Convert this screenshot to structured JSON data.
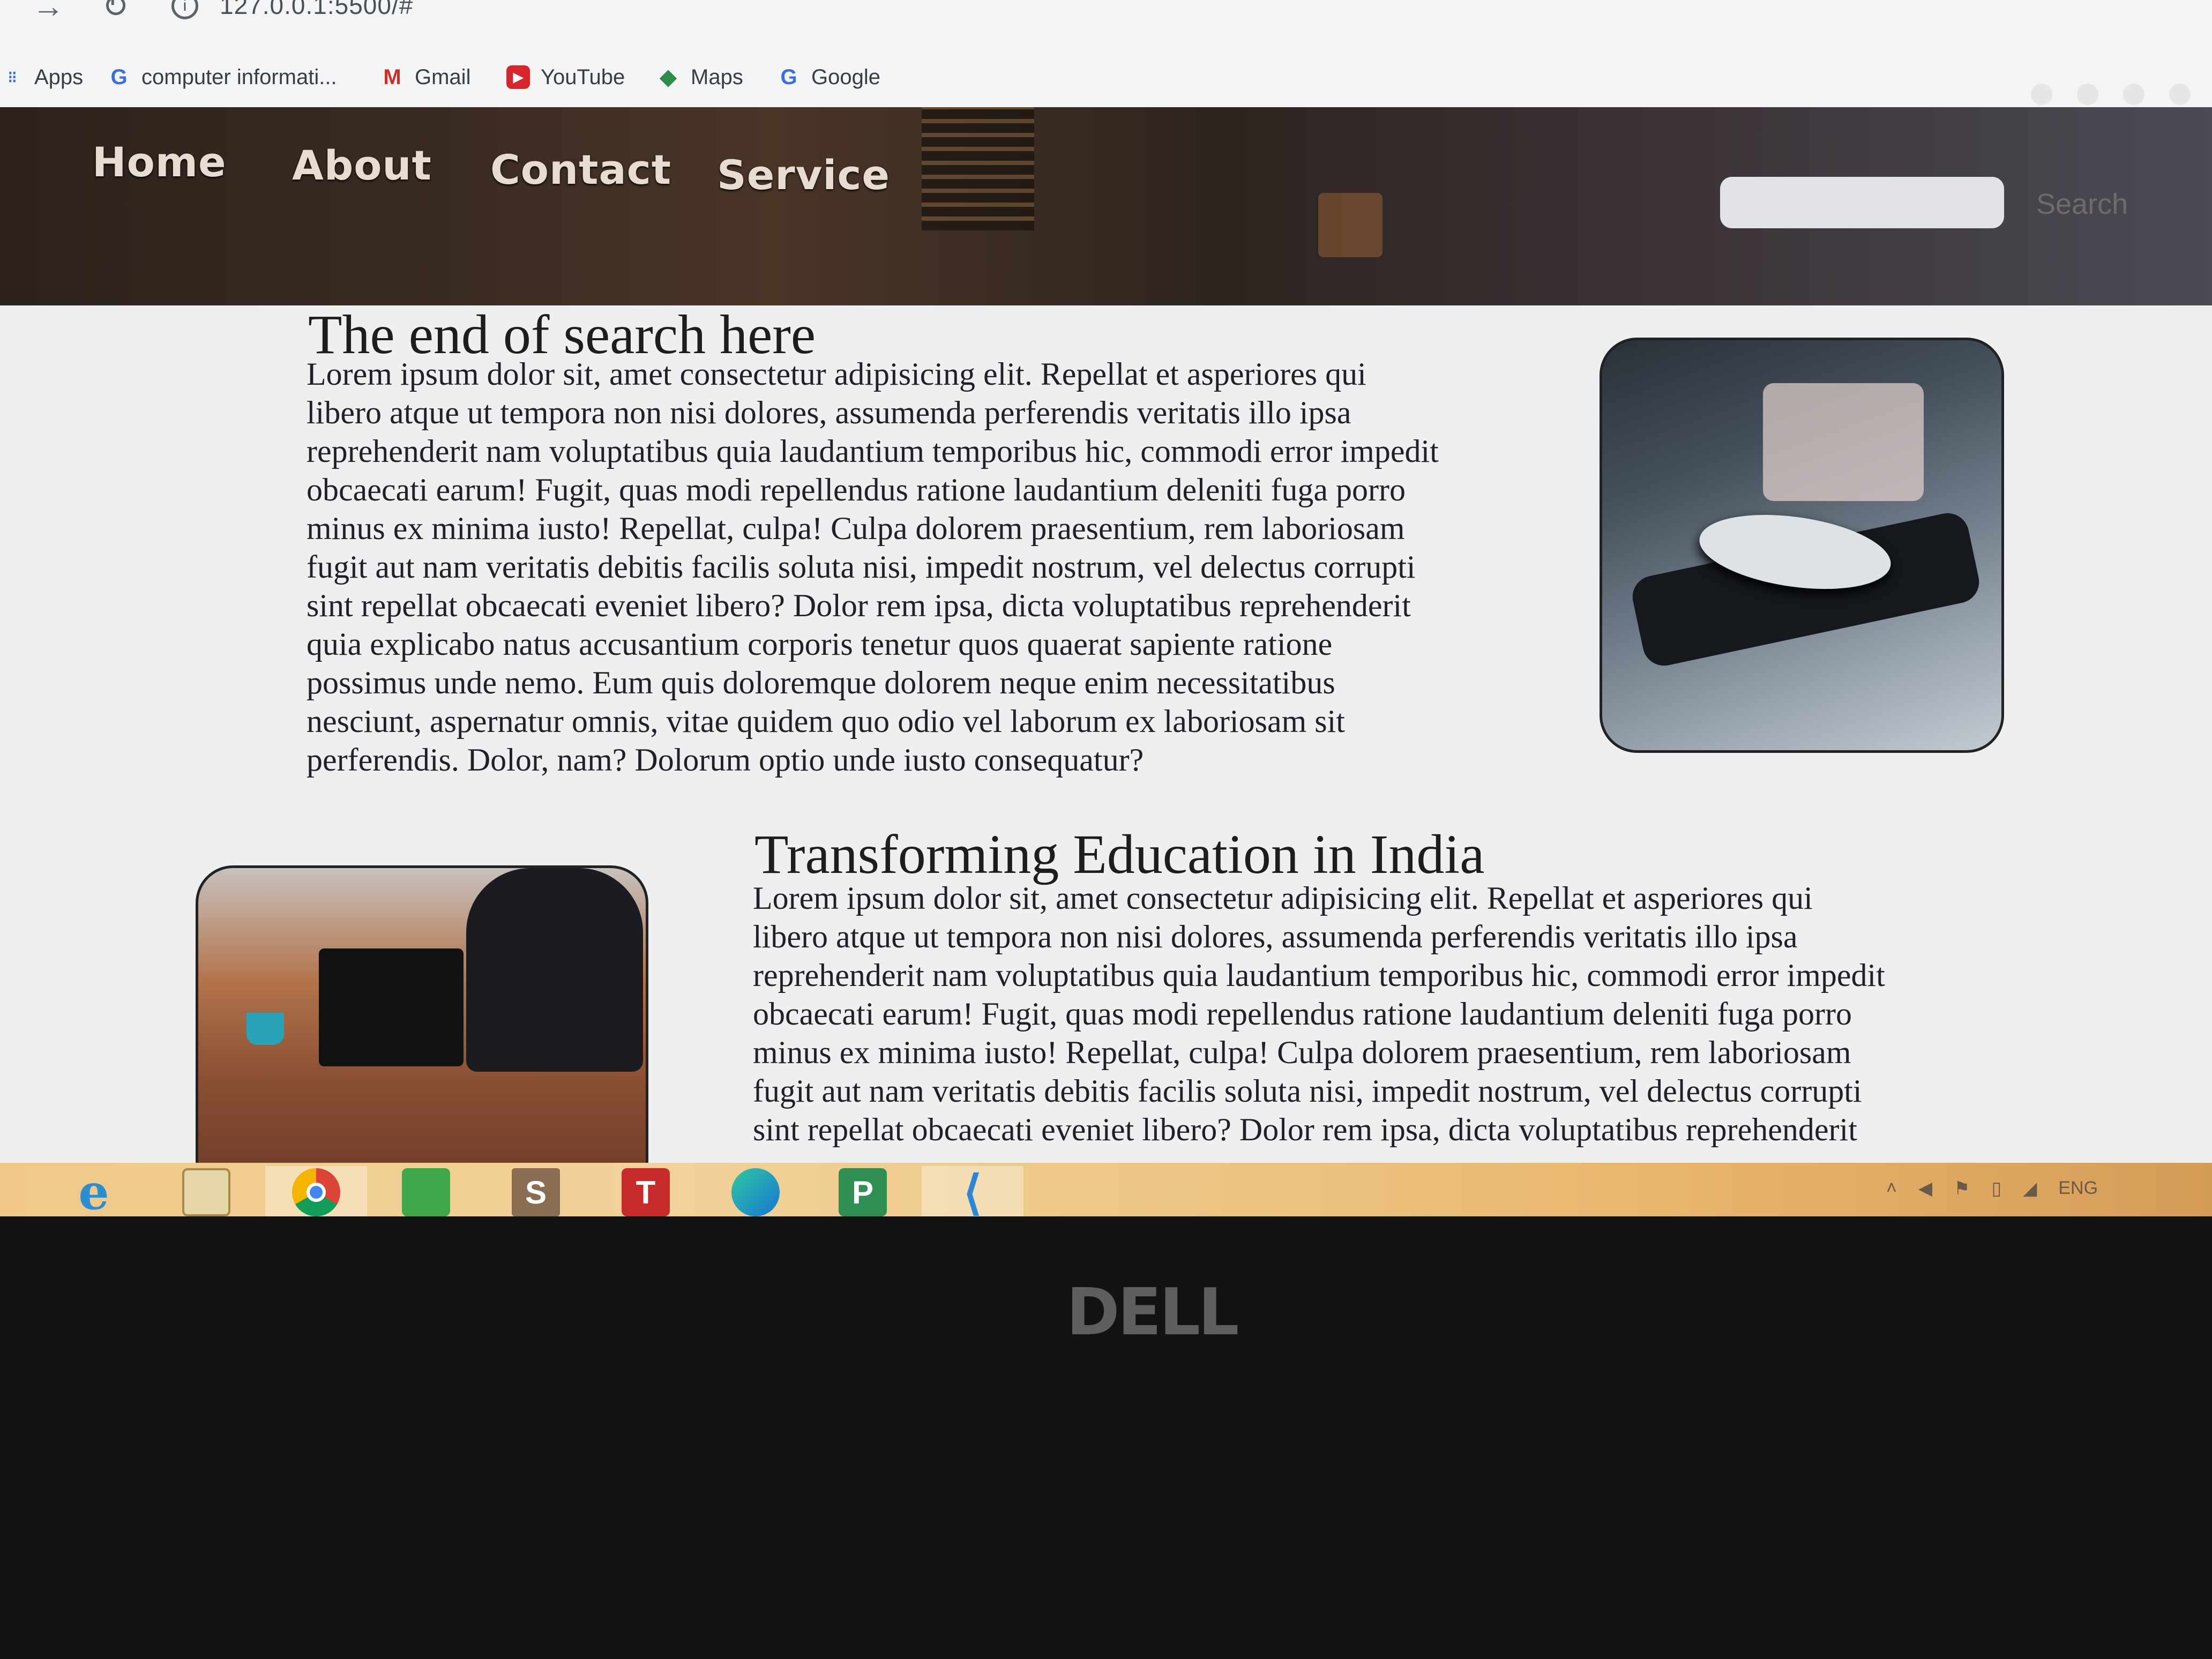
{
  "browser": {
    "url": "127.0.0.1:5500/#",
    "bookmarks": [
      {
        "label": "Apps",
        "icon": "apps-grid-icon"
      },
      {
        "label": "computer informati...",
        "icon": "google-icon"
      },
      {
        "label": "Gmail",
        "icon": "gmail-icon"
      },
      {
        "label": "YouTube",
        "icon": "youtube-icon"
      },
      {
        "label": "Maps",
        "icon": "maps-icon"
      },
      {
        "label": "Google",
        "icon": "google-icon"
      }
    ]
  },
  "site": {
    "nav": [
      "Home",
      "About",
      "Contact",
      "Service"
    ],
    "search": {
      "placeholder": "",
      "button": "Search"
    }
  },
  "sections": [
    {
      "title": "The end of search here",
      "lines": [
        "Lorem ipsum dolor sit, amet consectetur adipisicing elit. Repellat et asperiores qui",
        "libero atque ut tempora non nisi dolores, assumenda perferendis veritatis illo ipsa",
        "reprehenderit nam voluptatibus quia laudantium temporibus hic, commodi error impedit",
        "obcaecati earum! Fugit, quas modi repellendus ratione laudantium deleniti fuga porro",
        "minus ex minima iusto! Repellat, culpa! Culpa dolorem praesentium, rem laboriosam",
        "fugit aut nam veritatis debitis facilis soluta nisi, impedit nostrum, vel delectus corrupti",
        "sint repellat obcaecati eveniet libero? Dolor rem ipsa, dicta voluptatibus reprehenderit",
        "quia explicabo natus accusantium corporis tenetur quos quaerat sapiente ratione",
        "possimus unde nemo. Eum quis doloremque dolorem neque enim necessitatibus",
        "nesciunt, aspernatur omnis, vitae quidem quo odio vel laborum ex laboriosam sit",
        "perferendis. Dolor, nam? Dolorum optio unde iusto consequatur?"
      ]
    },
    {
      "title": "Transforming Education in India",
      "lines": [
        "Lorem ipsum dolor sit, amet consectetur adipisicing elit. Repellat et asperiores qui",
        "libero atque ut tempora non nisi dolores, assumenda perferendis veritatis illo ipsa",
        "reprehenderit nam voluptatibus quia laudantium temporibus hic, commodi error impedit",
        "obcaecati earum! Fugit, quas modi repellendus ratione laudantium deleniti fuga porro",
        "minus ex minima iusto! Repellat, culpa! Culpa dolorem praesentium, rem laboriosam",
        "fugit aut nam veritatis debitis facilis soluta nisi, impedit nostrum, vel delectus corrupti",
        "sint repellat obcaecati eveniet libero? Dolor rem ipsa, dicta voluptatibus reprehenderit"
      ]
    }
  ],
  "taskbar": {
    "apps": [
      {
        "name": "internet-explorer-icon",
        "glyph": "e"
      },
      {
        "name": "file-explorer-icon",
        "glyph": ""
      },
      {
        "name": "chrome-icon",
        "glyph": ""
      },
      {
        "name": "store-icon",
        "glyph": ""
      },
      {
        "name": "sway-icon",
        "glyph": "S"
      },
      {
        "name": "teams-icon",
        "glyph": "T"
      },
      {
        "name": "edge-icon",
        "glyph": ""
      },
      {
        "name": "project-icon",
        "glyph": "P"
      },
      {
        "name": "vscode-icon",
        "glyph": "⟨"
      }
    ],
    "tray_lang": "ENG"
  },
  "bezel": {
    "brand": "DELL"
  },
  "colors": {
    "header_dark": "#2d221c",
    "nav_text": "#e8dcd2",
    "taskbar": "#f0c98a"
  }
}
